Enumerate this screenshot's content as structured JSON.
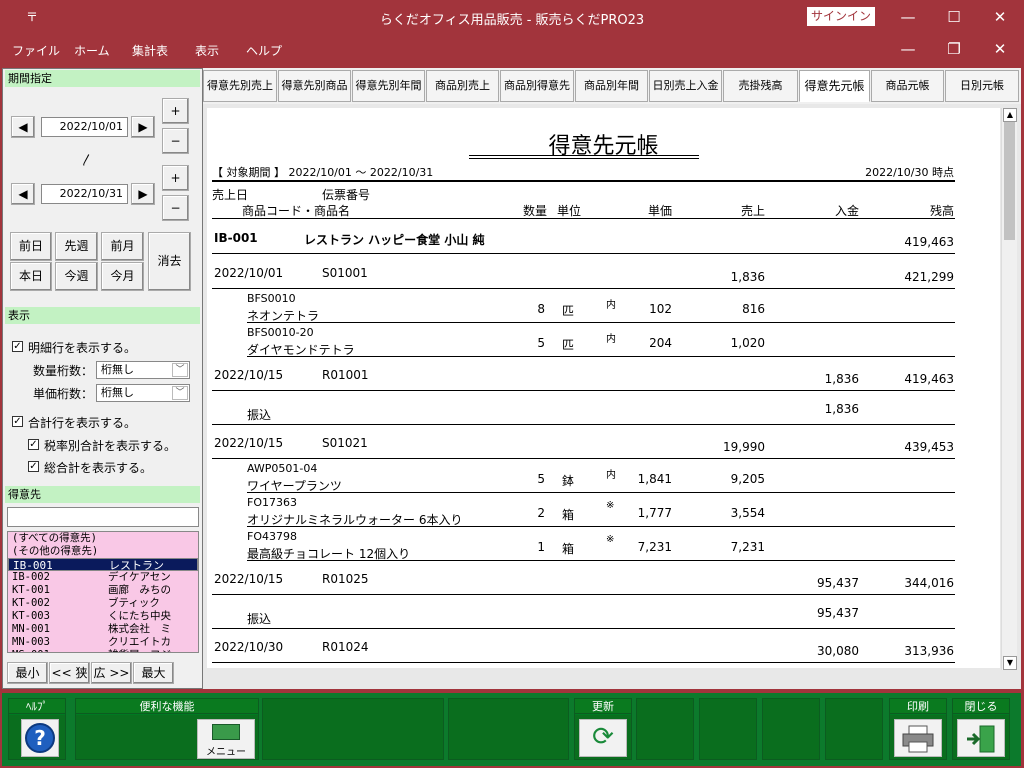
{
  "window": {
    "title": "らくだオフィス用品販売 - 販売らくだPRO23",
    "signin": "サインイン",
    "menu_glyph": "〒"
  },
  "menu": [
    "ファイル",
    "ホーム",
    "集計表",
    "表示",
    "ヘルプ"
  ],
  "period": {
    "header": "期間指定",
    "from": "2022/10/01",
    "tilde": "〳",
    "to": "2022/10/31",
    "plus": "+",
    "minus": "−",
    "prev": "◀",
    "next": "▶",
    "quick": [
      "前日",
      "先週",
      "前月",
      "本日",
      "今週",
      "今月"
    ],
    "clear": "消去"
  },
  "display": {
    "header": "表示",
    "show_detail": "明細行を表示する。",
    "qty_digits_label": "数量桁数：",
    "qty_digits": "桁無し",
    "price_digits_label": "単価桁数：",
    "price_digits": "桁無し",
    "show_total": "合計行を表示する。",
    "show_tax_total": "税率別合計を表示する。",
    "show_grand_total": "総合計を表示する。",
    "check": "✓"
  },
  "customer": {
    "header": "得意先",
    "search": "",
    "list": [
      {
        "code": "(すべての得意先)",
        "name": ""
      },
      {
        "code": "(その他の得意先)",
        "name": ""
      },
      {
        "code": "IB-001",
        "name": "レストラン"
      },
      {
        "code": "IB-002",
        "name": "デイケアセン"
      },
      {
        "code": "KT-001",
        "name": "画廊　みちの"
      },
      {
        "code": "KT-002",
        "name": "ブティック　"
      },
      {
        "code": "KT-003",
        "name": "くにたち中央"
      },
      {
        "code": "MN-001",
        "name": "株式会社　ミ"
      },
      {
        "code": "MN-003",
        "name": "クリエイトカ"
      },
      {
        "code": "MS-001",
        "name": "雑貨屋　フジ"
      }
    ],
    "selected_index": 2,
    "size_buttons": [
      "最小",
      "<< 狭",
      "広 >>",
      "最大"
    ]
  },
  "tabs": [
    "得意先別売上",
    "得意先別商品",
    "得意先別年間",
    "商品別売上",
    "商品別得意先",
    "商品別年間",
    "日別売上入金",
    "売掛残高",
    "得意先元帳",
    "商品元帳",
    "日別元帳"
  ],
  "active_tab": 8,
  "report": {
    "title": "得意先元帳",
    "period_label": "【 対象期間 】 2022/10/01 ～ 2022/10/31",
    "as_of": "2022/10/30 時点",
    "col": {
      "sales_date": "売上日",
      "slip_no": "伝票番号",
      "product": "商品コード・商品名",
      "qty": "数量",
      "unit": "単位",
      "unit_price": "単価",
      "sales": "売上",
      "payment": "入金",
      "balance": "残高"
    },
    "customer_code": "IB-001",
    "customer_name": "レストラン ハッピー食堂 小山 純",
    "opening_balance": "419,463",
    "rows": [
      {
        "kind": "slip",
        "date": "2022/10/01",
        "slip": "S01001",
        "sales": "1,836",
        "payment": "",
        "balance": "421,299"
      },
      {
        "kind": "item",
        "code": "BFS0010",
        "name": "ネオンテトラ",
        "qty": "8",
        "unit": "匹",
        "tax": "内",
        "price": "102",
        "sales": "816"
      },
      {
        "kind": "item",
        "code": "BFS0010-20",
        "name": "ダイヤモンドテトラ",
        "qty": "5",
        "unit": "匹",
        "tax": "内",
        "price": "204",
        "sales": "1,020"
      },
      {
        "kind": "slip",
        "date": "2022/10/15",
        "slip": "R01001",
        "sales": "",
        "payment": "1,836",
        "balance": "419,463"
      },
      {
        "kind": "pay",
        "name": "振込",
        "payment": "1,836"
      },
      {
        "kind": "slip",
        "date": "2022/10/15",
        "slip": "S01021",
        "sales": "19,990",
        "payment": "",
        "balance": "439,453"
      },
      {
        "kind": "item",
        "code": "AWP0501-04",
        "name": "ワイヤープランツ",
        "qty": "5",
        "unit": "鉢",
        "tax": "内",
        "price": "1,841",
        "sales": "9,205"
      },
      {
        "kind": "item",
        "code": "FO17363",
        "name": "オリジナルミネラルウォーター 6本入り",
        "qty": "2",
        "unit": "箱",
        "tax": "※",
        "price": "1,777",
        "sales": "3,554"
      },
      {
        "kind": "item",
        "code": "FO43798",
        "name": "最高級チョコレート 12個入り",
        "qty": "1",
        "unit": "箱",
        "tax": "※",
        "price": "7,231",
        "sales": "7,231"
      },
      {
        "kind": "slip",
        "date": "2022/10/15",
        "slip": "R01025",
        "sales": "",
        "payment": "95,437",
        "balance": "344,016"
      },
      {
        "kind": "pay",
        "name": "振込",
        "payment": "95,437"
      },
      {
        "kind": "slip",
        "date": "2022/10/30",
        "slip": "R01024",
        "sales": "",
        "payment": "30,080",
        "balance": "313,936"
      }
    ]
  },
  "toolbar": {
    "help": "ﾍﾙﾌﾟ",
    "help_glyph": "?",
    "tools": "便利な機能",
    "menu": "メニュー",
    "update": "更新",
    "print": "印刷",
    "close": "閉じる"
  },
  "colors": {
    "titlebar": "#a2343c",
    "section_header": "#c3f2c3",
    "customer_list": "#f9c8e6",
    "selected_row": "#0a1a5c",
    "toolbar": "#0c7a2c"
  }
}
